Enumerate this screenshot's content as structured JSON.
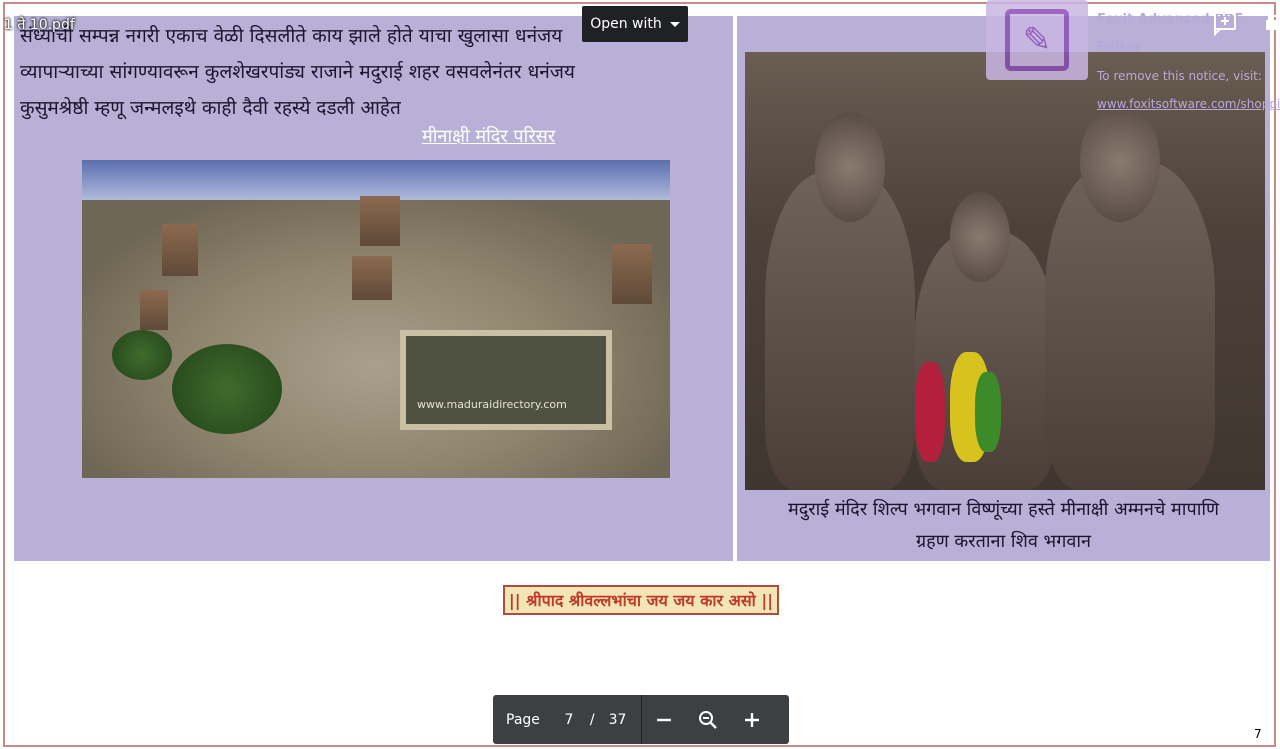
{
  "viewer": {
    "file_title": "1 ते 10.pdf",
    "open_with_label": "Open with",
    "page_label": "Page",
    "current_page": "7",
    "page_separator": "/",
    "total_pages": "37",
    "corner_page_number": "7"
  },
  "document": {
    "body_lines": [
      "संध्याची सम्पन्न नगरी एकाच वेळी दिसलीते काय झाले होते याचा खुलासा धनंजय",
      "व्यापाऱ्याच्या सांगण्यावरून कुलशेखरपांड्य राजाने मदुराई शहर वसवलेनंतर धनंजय",
      "कुसुमश्रेष्ठी म्हणू जन्मलइथे काही दैवी रहस्ये दडली आहेत"
    ],
    "left_photo_caption": "मीनाक्षी मंदिर परिसर",
    "left_photo_watermark": "www.maduraidirectory.com",
    "right_photo_caption_line1": "मदुराई मंदिर शिल्प  भगवान विष्णूंच्या हस्ते मीनाक्षी अम्मनचे मापाणि",
    "right_photo_caption_line2": "ग्रहण करताना शिव भगवान",
    "banner_text": "|| श्रीपाद श्रीवल्लभांचा जय जय कार असो ||"
  },
  "foxit_notice": {
    "title": "Foxit Advanced PDF Editor",
    "line2": "To remove this notice, visit:",
    "link": "www.foxitsoftware.com/shopping"
  },
  "icons": {
    "open_with_caret": "caret-down-icon",
    "add_comment": "add-comment-icon",
    "zoom_out": "minus-icon",
    "zoom": "magnifier-minus-icon",
    "zoom_in": "plus-icon"
  }
}
